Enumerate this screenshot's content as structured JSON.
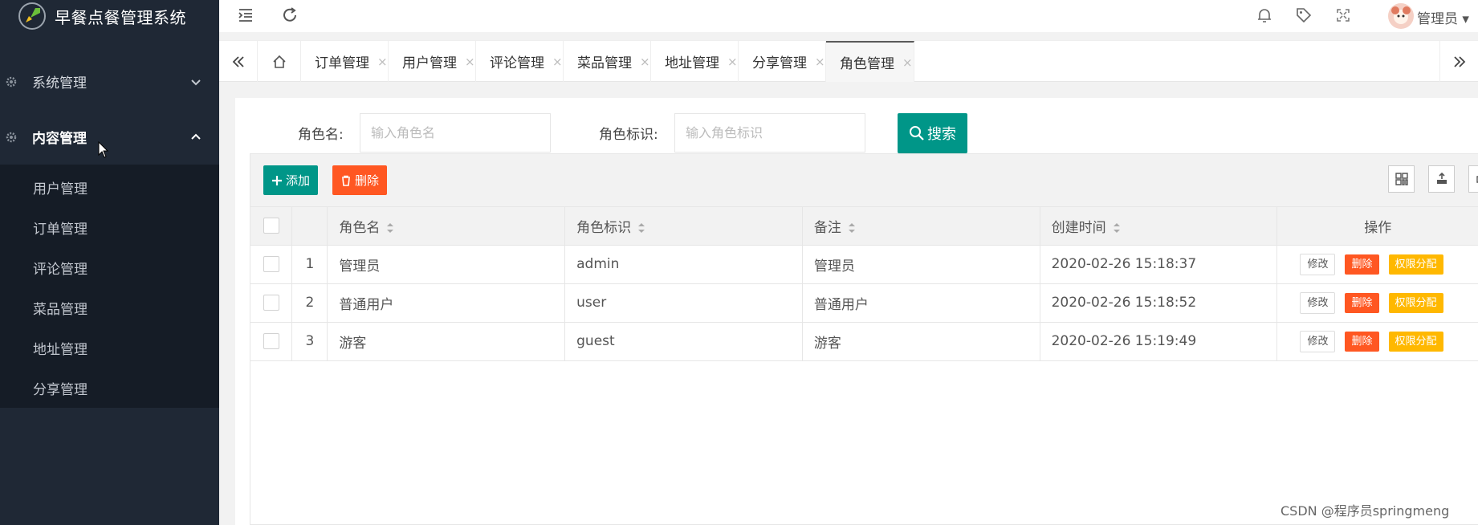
{
  "app": {
    "title": "早餐点餐管理系统"
  },
  "sidebar": {
    "groups": [
      {
        "label": "系统管理",
        "expanded": false
      },
      {
        "label": "内容管理",
        "expanded": true
      }
    ],
    "items": [
      "用户管理",
      "订单管理",
      "评论管理",
      "菜品管理",
      "地址管理",
      "分享管理"
    ]
  },
  "header": {
    "user": "管理员"
  },
  "tabs": [
    {
      "label": "订单管理"
    },
    {
      "label": "用户管理"
    },
    {
      "label": "评论管理"
    },
    {
      "label": "菜品管理"
    },
    {
      "label": "地址管理"
    },
    {
      "label": "分享管理"
    },
    {
      "label": "角色管理",
      "active": true
    }
  ],
  "tab_close": "×",
  "search": {
    "role_name_label": "角色名:",
    "role_name_placeholder": "输入角色名",
    "role_key_label": "角色标识:",
    "role_key_placeholder": "输入角色标识",
    "search_button": "搜索"
  },
  "toolbar": {
    "add_label": "添加",
    "delete_label": "删除"
  },
  "table": {
    "columns": [
      "角色名",
      "角色标识",
      "备注",
      "创建时间",
      "操作"
    ],
    "rows": [
      {
        "index": "1",
        "name": "管理员",
        "key": "admin",
        "remark": "管理员",
        "created": "2020-02-26 15:18:37"
      },
      {
        "index": "2",
        "name": "普通用户",
        "key": "user",
        "remark": "普通用户",
        "created": "2020-02-26 15:18:52"
      },
      {
        "index": "3",
        "name": "游客",
        "key": "guest",
        "remark": "游客",
        "created": "2020-02-26 15:19:49"
      }
    ],
    "row_actions": {
      "edit": "修改",
      "delete": "删除",
      "permissions": "权限分配"
    }
  },
  "watermark": "CSDN @程序员springmeng",
  "colors": {
    "sidebar": "#1f2835",
    "primary": "#009688",
    "danger": "#ff5722",
    "warning": "#ffb800"
  }
}
